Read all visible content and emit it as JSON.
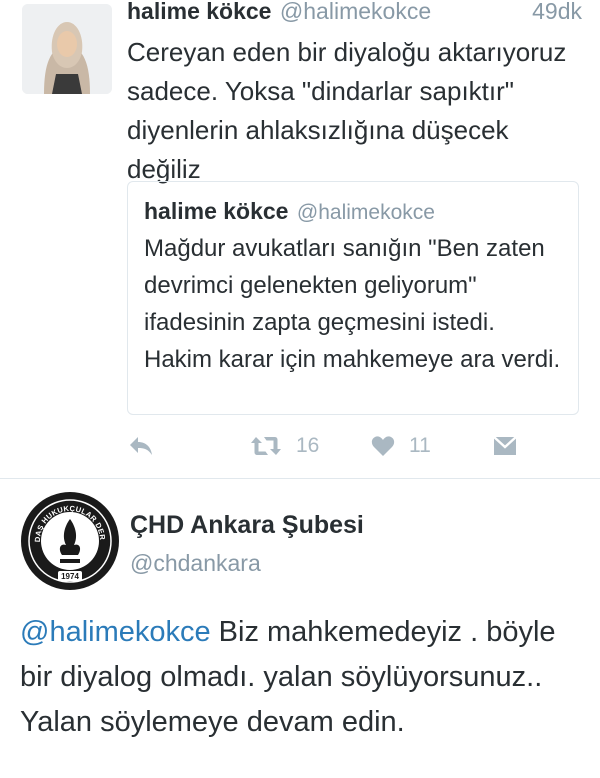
{
  "tweet1": {
    "author_name": "halime kökce",
    "author_handle": "@halimekokce",
    "time": "49dk",
    "text": "Cereyan eden bir diyaloğu aktarıyoruz sadece. Yoksa \"dindarlar sapıktır\" diyenlerin ahlaksızlığına düşecek değiliz",
    "quoted": {
      "author_name": "halime kökce",
      "author_handle": "@halimekokce",
      "text": "Mağdur avukatları sanığın \"Ben zaten devrimci gelenekten geliyorum\" ifadesinin zapta geçmesini istedi. Hakim karar için mahkemeye ara verdi."
    },
    "actions": {
      "retweet_count": "16",
      "like_count": "11"
    }
  },
  "tweet2": {
    "author_name": "ÇHD Ankara Şubesi",
    "author_handle": "@chdankara",
    "logo_text_top": "ÇAĞDAŞ HUKUKÇULAR DERNEĞİ",
    "logo_year": "1974",
    "mention": "@halimekokce",
    "text": " Biz mahkemedeyiz . böyle bir diyalog olmadı. yalan söylüyorsunuz.. Yalan söylemeye devam edin."
  },
  "colors": {
    "text": "#292f33",
    "secondary": "#8899a6",
    "icon": "#aab8c2",
    "link": "#2b7bb9",
    "border": "#e1e8ed"
  },
  "icons": [
    "reply-icon",
    "retweet-icon",
    "heart-icon",
    "message-icon"
  ]
}
